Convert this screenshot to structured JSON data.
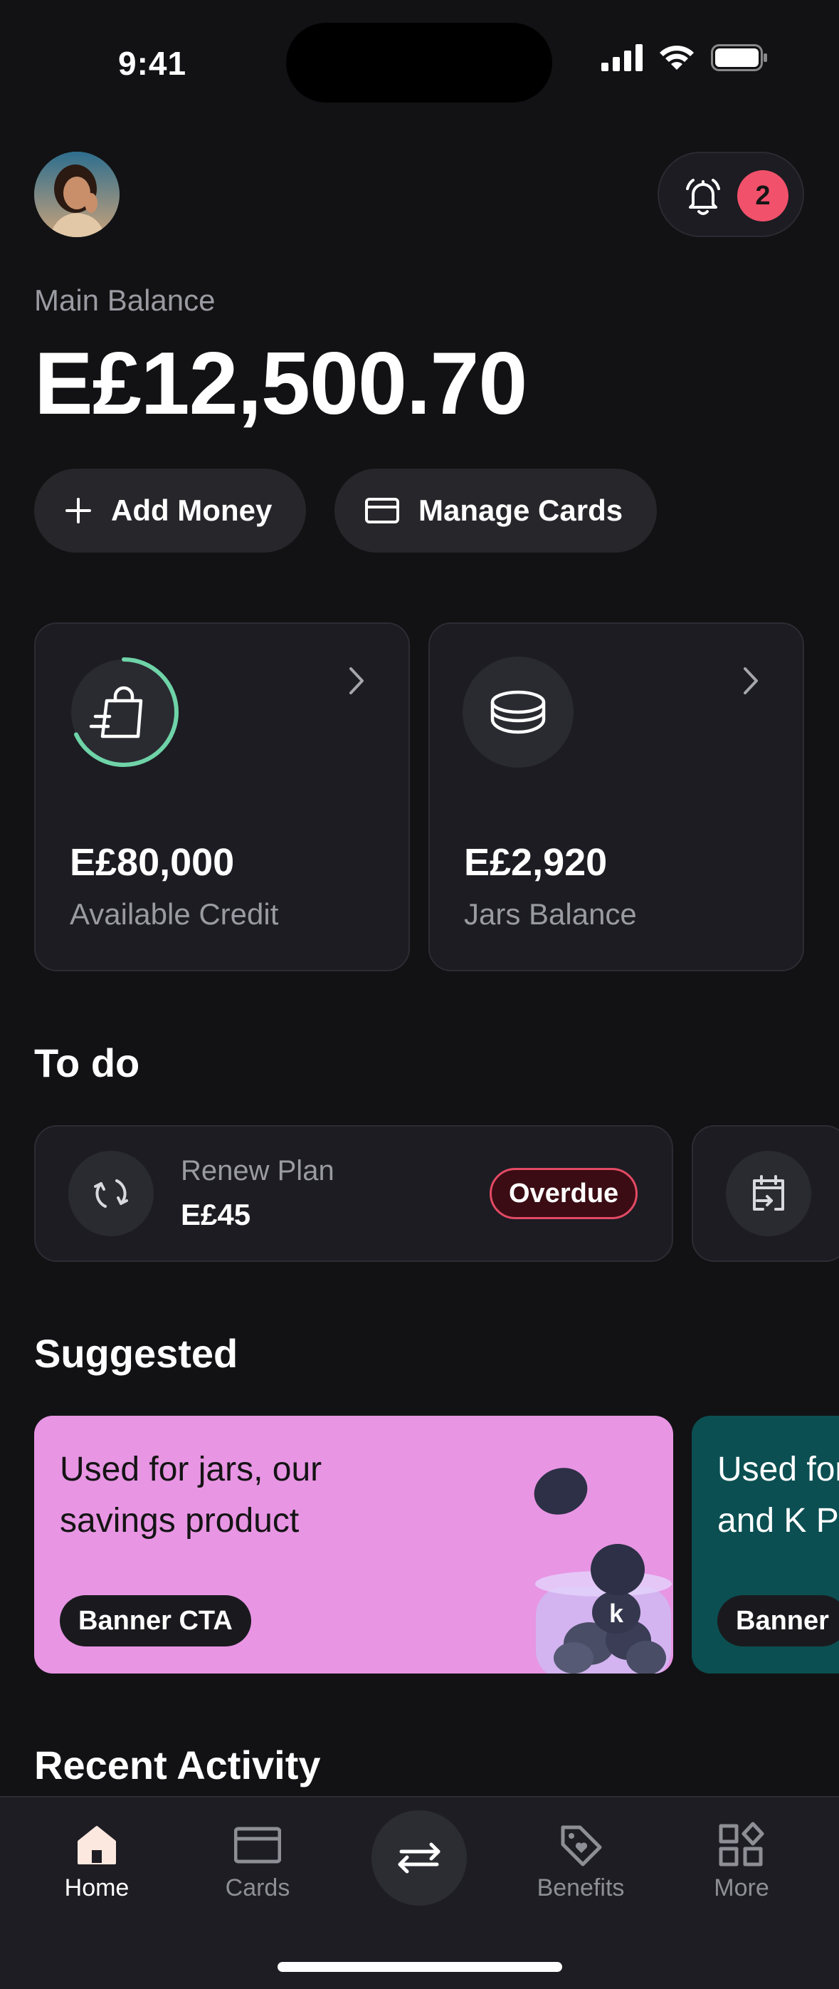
{
  "status_bar": {
    "time": "9:41"
  },
  "header": {
    "notifications_count": "2"
  },
  "balance": {
    "label": "Main Balance",
    "value": "E£12,500.70"
  },
  "actions": {
    "add_money": "Add Money",
    "manage_cards": "Manage Cards"
  },
  "summary_cards": [
    {
      "amount": "E£80,000",
      "label": "Available Credit",
      "progress_fraction": 0.68
    },
    {
      "amount": "E£2,920",
      "label": "Jars Balance"
    }
  ],
  "todo": {
    "title": "To do",
    "items": [
      {
        "label": "Renew Plan",
        "amount": "E£45",
        "status": "Overdue"
      }
    ]
  },
  "suggested": {
    "title": "Suggested",
    "banners": [
      {
        "text": "Used for jars, our savings product",
        "cta": "Banner CTA",
        "color": "#e895e4"
      },
      {
        "text": "Used for and K P",
        "cta": "Banner",
        "color": "#0b4f52"
      }
    ]
  },
  "recent": {
    "title": "Recent Activity"
  },
  "tabbar": {
    "home": "Home",
    "cards": "Cards",
    "benefits": "Benefits",
    "more": "More"
  },
  "colors": {
    "background": "#121214",
    "surface": "#1c1c22",
    "accent_green": "#6fd3a8",
    "badge_red": "#f2516b"
  }
}
